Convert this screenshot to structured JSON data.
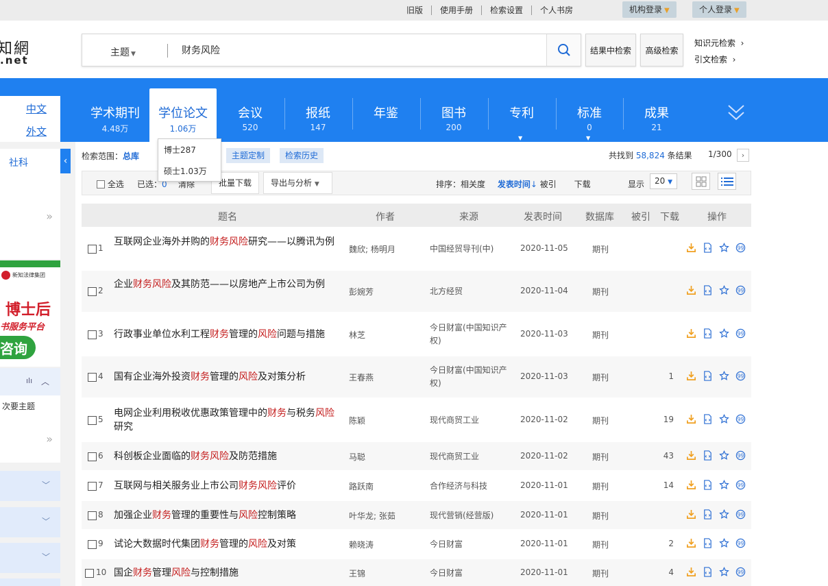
{
  "topbar": {
    "links": [
      "旧版",
      "使用手册",
      "检索设置",
      "个人书房"
    ],
    "org_login": "机构登录",
    "personal_login": "个人登录"
  },
  "logo": {
    "top": "知網",
    "bottom": ".net"
  },
  "search": {
    "scope": "主题",
    "query": "财务风险",
    "search_in_results": "结果中检索",
    "advanced": "高级检索",
    "knowledge_search": "知识元检索",
    "citation_search": "引文检索"
  },
  "lang": {
    "zh": "中文",
    "foreign": "外文"
  },
  "tabs": [
    {
      "label": "学术期刊",
      "count": "4.48万"
    },
    {
      "label": "学位论文",
      "count": "1.06万"
    },
    {
      "label": "会议",
      "count": "520"
    },
    {
      "label": "报纸",
      "count": "147"
    },
    {
      "label": "年鉴",
      "count": ""
    },
    {
      "label": "图书",
      "count": "200"
    },
    {
      "label": "专利",
      "count": ""
    },
    {
      "label": "标准",
      "count": "0"
    },
    {
      "label": "成果",
      "count": "21"
    }
  ],
  "dropdown": {
    "phd": "博士287",
    "master": "硕士1.03万"
  },
  "sidebar": {
    "category": "社科",
    "secondary_topic": "次要主题",
    "more": "»",
    "promo": {
      "line1": "博士后",
      "line2": "书服务平台",
      "line3": "咨询",
      "company": "新知法律集团"
    }
  },
  "results_bar": {
    "scope_label": "检索范围：",
    "scope_value": "总库",
    "topic_custom": "主题定制",
    "history": "检索历史",
    "found_prefix": "共找到",
    "found_count": "58,824",
    "found_suffix": "条结果",
    "page": "1/300"
  },
  "toolbar": {
    "select_all": "全选",
    "selected_label": "已选：",
    "selected_count": "0",
    "clear": "清除",
    "batch_download": "批量下载",
    "export": "导出与分析",
    "sort_label": "排序：",
    "sort_relevance": "相关度",
    "sort_date": "发表时间",
    "sort_cited": "被引",
    "sort_download": "下载",
    "display_label": "显示",
    "page_size": "20"
  },
  "columns": [
    "题名",
    "作者",
    "来源",
    "发表时间",
    "数据库",
    "被引",
    "下载",
    "操作"
  ],
  "rows": [
    {
      "num": "1",
      "title_parts": [
        [
          "互联网企业海外并购的",
          false
        ],
        [
          "财务风险",
          true
        ],
        [
          "研究——以腾讯为例",
          false
        ]
      ],
      "author": "魏欣; 杨明月",
      "source": "中国经贸导刊(中)",
      "date": "2020-11-05",
      "db": "期刊",
      "cited": ""
    },
    {
      "num": "2",
      "title_parts": [
        [
          "企业",
          false
        ],
        [
          "财务风险",
          true
        ],
        [
          "及其防范——以房地产上市公司为例",
          false
        ]
      ],
      "author": "彭婉芳",
      "source": "北方经贸",
      "date": "2020-11-04",
      "db": "期刊",
      "cited": ""
    },
    {
      "num": "3",
      "title_parts": [
        [
          "行政事业单位水利工程",
          false
        ],
        [
          "财务",
          true
        ],
        [
          "管理的",
          false
        ],
        [
          "风险",
          true
        ],
        [
          "问题与措施",
          false
        ]
      ],
      "author": "林芝",
      "source": "今日财富(中国知识产权)",
      "date": "2020-11-03",
      "db": "期刊",
      "cited": ""
    },
    {
      "num": "4",
      "title_parts": [
        [
          "国有企业海外投资",
          false
        ],
        [
          "财务",
          true
        ],
        [
          "管理的",
          false
        ],
        [
          "风险",
          true
        ],
        [
          "及对策分析",
          false
        ]
      ],
      "author": "王春燕",
      "source": "今日财富(中国知识产权)",
      "date": "2020-11-03",
      "db": "期刊",
      "cited": "1"
    },
    {
      "num": "5",
      "title_parts": [
        [
          "电网企业利用税收优惠政策管理中的",
          false
        ],
        [
          "财务",
          true
        ],
        [
          "与税务",
          false
        ],
        [
          "风险",
          true
        ],
        [
          "研究",
          false
        ]
      ],
      "author": "陈颖",
      "source": "现代商贸工业",
      "date": "2020-11-02",
      "db": "期刊",
      "cited": "19"
    },
    {
      "num": "6",
      "title_parts": [
        [
          "科创板企业面临的",
          false
        ],
        [
          "财务风险",
          true
        ],
        [
          "及防范措施",
          false
        ]
      ],
      "author": "马聪",
      "source": "现代商贸工业",
      "date": "2020-11-02",
      "db": "期刊",
      "cited": "43"
    },
    {
      "num": "7",
      "title_parts": [
        [
          "互联网与相关服务业上市公司",
          false
        ],
        [
          "财务风险",
          true
        ],
        [
          "评价",
          false
        ]
      ],
      "author": "路跃南",
      "source": "合作经济与科技",
      "date": "2020-11-01",
      "db": "期刊",
      "cited": "14"
    },
    {
      "num": "8",
      "title_parts": [
        [
          "加强企业",
          false
        ],
        [
          "财务",
          true
        ],
        [
          "管理的重要性与",
          false
        ],
        [
          "风险",
          true
        ],
        [
          "控制策略",
          false
        ]
      ],
      "author": "叶华龙; 张茹",
      "source": "现代营销(经营版)",
      "date": "2020-11-01",
      "db": "期刊",
      "cited": ""
    },
    {
      "num": "9",
      "title_parts": [
        [
          "试论大数据时代集团",
          false
        ],
        [
          "财务",
          true
        ],
        [
          "管理的",
          false
        ],
        [
          "风险",
          true
        ],
        [
          "及对策",
          false
        ]
      ],
      "author": "赖晓涛",
      "source": "今日财富",
      "date": "2020-11-01",
      "db": "期刊",
      "cited": "2"
    },
    {
      "num": "10",
      "title_parts": [
        [
          "国企",
          false
        ],
        [
          "财务",
          true
        ],
        [
          "管理",
          false
        ],
        [
          "风险",
          true
        ],
        [
          "与控制措施",
          false
        ]
      ],
      "author": "王锦",
      "source": "今日财富",
      "date": "2020-11-01",
      "db": "期刊",
      "cited": "4"
    }
  ],
  "colors": {
    "primary_blue": "#1f80f0",
    "highlight_red": "#c41d1d",
    "download_orange": "#f0a020",
    "icon_blue": "#2d6fd4"
  }
}
